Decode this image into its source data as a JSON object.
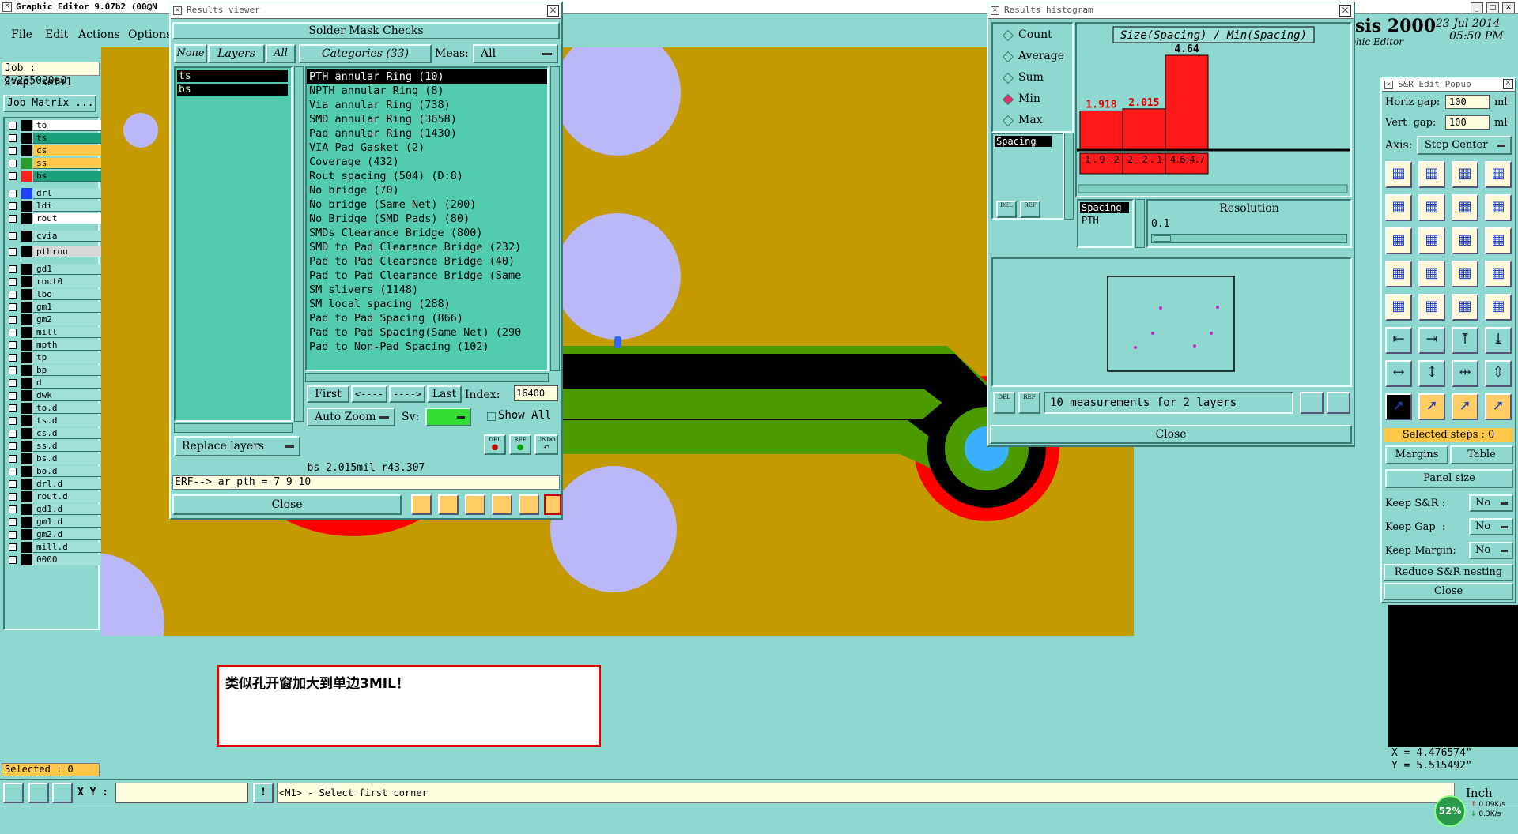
{
  "app": {
    "title": "Graphic Editor 9.07b2 (00@N",
    "menu": [
      "File",
      "Edit",
      "Actions",
      "Options"
    ],
    "job": "Job : 2v255020a0",
    "step": "Step: set+1",
    "job_matrix": "Job Matrix ...",
    "selected": "Selected : 0",
    "brand": "esis 2000",
    "brand_sub": "aphic Editor",
    "date": "23 Jul 2014",
    "time": "05:50 PM"
  },
  "layers": [
    {
      "name": "to",
      "color": "#ffffff",
      "sw": "#000000"
    },
    {
      "name": "ts",
      "color": "#1aa07a",
      "sw": "#000000"
    },
    {
      "name": "cs",
      "color": "#ffc84a",
      "sw": "#000000"
    },
    {
      "name": "ss",
      "color": "#ffc84a",
      "sw": "#2a9a2a"
    },
    {
      "name": "bs",
      "color": "#1aa07a",
      "sw": "#ff2020"
    },
    {
      "name": "drl",
      "color": "#9fe0d8",
      "sw": "#2040ff"
    },
    {
      "name": "ldi",
      "color": "#9fe0d8",
      "sw": "#000000"
    },
    {
      "name": "rout",
      "color": "#ffffff",
      "sw": "#000000"
    },
    {
      "name": "cvia",
      "color": "#9fe0d8",
      "sw": "#000000"
    },
    {
      "name": "pthrou",
      "color": "#d8d8d8",
      "sw": "#000000"
    },
    {
      "name": "gd1",
      "color": "#9fe0d8",
      "sw": "#000000"
    },
    {
      "name": "rout0",
      "color": "#9fe0d8",
      "sw": "#000000"
    },
    {
      "name": "lbo",
      "color": "#9fe0d8",
      "sw": "#000000"
    },
    {
      "name": "gm1",
      "color": "#9fe0d8",
      "sw": "#000000"
    },
    {
      "name": "gm2",
      "color": "#9fe0d8",
      "sw": "#000000"
    },
    {
      "name": "mill",
      "color": "#9fe0d8",
      "sw": "#000000"
    },
    {
      "name": "mpth",
      "color": "#9fe0d8",
      "sw": "#000000"
    },
    {
      "name": "tp",
      "color": "#9fe0d8",
      "sw": "#000000"
    },
    {
      "name": "bp",
      "color": "#9fe0d8",
      "sw": "#000000"
    },
    {
      "name": "d",
      "color": "#9fe0d8",
      "sw": "#000000"
    },
    {
      "name": "dwk",
      "color": "#9fe0d8",
      "sw": "#000000"
    },
    {
      "name": "to.d",
      "color": "#9fe0d8",
      "sw": "#000000"
    },
    {
      "name": "ts.d",
      "color": "#9fe0d8",
      "sw": "#000000"
    },
    {
      "name": "cs.d",
      "color": "#9fe0d8",
      "sw": "#000000"
    },
    {
      "name": "ss.d",
      "color": "#9fe0d8",
      "sw": "#000000"
    },
    {
      "name": "bs.d",
      "color": "#9fe0d8",
      "sw": "#000000"
    },
    {
      "name": "bo.d",
      "color": "#9fe0d8",
      "sw": "#000000"
    },
    {
      "name": "drl.d",
      "color": "#9fe0d8",
      "sw": "#000000"
    },
    {
      "name": "rout.d",
      "color": "#9fe0d8",
      "sw": "#000000"
    },
    {
      "name": "gd1.d",
      "color": "#9fe0d8",
      "sw": "#000000"
    },
    {
      "name": "gm1.d",
      "color": "#9fe0d8",
      "sw": "#000000"
    },
    {
      "name": "gm2.d",
      "color": "#9fe0d8",
      "sw": "#000000"
    },
    {
      "name": "mill.d",
      "color": "#9fe0d8",
      "sw": "#000000"
    },
    {
      "name": "0000",
      "color": "#9fe0d8",
      "sw": "#000000"
    }
  ],
  "results": {
    "title": "Results viewer",
    "header": "Solder Mask Checks",
    "none": "None",
    "layers_tab": "Layers",
    "all": "All",
    "categories": "Categories (33)",
    "meas_label": "Meas:",
    "meas_value": "All",
    "layer_list": [
      "ts",
      "bs"
    ],
    "items": [
      "PTH annular Ring (10)",
      "NPTH annular Ring (8)",
      "Via annular Ring (738)",
      "SMD annular Ring (3658)",
      "Pad annular Ring (1430)",
      "VIA Pad Gasket (2)",
      "Coverage (432)",
      "Rout spacing (504)        (D:8)",
      "No bridge (70)",
      "No bridge (Same Net) (200)",
      "No Bridge (SMD Pads) (80)",
      "SMDs Clearance Bridge (800)",
      "SMD to Pad Clearance Bridge (232)",
      "Pad to Pad Clearance Bridge (40)",
      "Pad to Pad Clearance Bridge (Same",
      "SM slivers (1148)",
      "SM local spacing (288)",
      "Pad to Pad Spacing (866)",
      "Pad to Pad Spacing(Same Net) (290",
      "Pad to Non-Pad Spacing (102)"
    ],
    "first": "First",
    "prev": "<----",
    "next": "---->",
    "last": "Last",
    "index_label": "Index:",
    "index_value": "16400",
    "auto_zoom": "Auto Zoom",
    "sv": "Sv:",
    "show_all": "Show All",
    "replace": "Replace layers",
    "status": "bs 2.015mil  r43.307",
    "erf": "ERF--> ar_pth = 7 9 10",
    "close": "Close",
    "del": "DEL",
    "ref": "REF",
    "undo": "UNDO"
  },
  "histogram": {
    "title": "Results histogram",
    "options": [
      "Count",
      "Average",
      "Sum",
      "Min",
      "Max"
    ],
    "selected_option": "Min",
    "list1": "Spacing",
    "chart_title": "Size(Spacing) / Min(Spacing)",
    "list2": [
      "Spacing",
      "PTH"
    ],
    "resolution_label": "Resolution",
    "resolution_value": "0.1",
    "info": "10 measurements for 2 layers",
    "close": "Close",
    "del": "DEL",
    "ref": "REF"
  },
  "chart_data": {
    "type": "bar",
    "title": "Size(Spacing) / Min(Spacing)",
    "categories": [
      "1.9-2",
      "2-2.1",
      "4.6-4.7"
    ],
    "values": [
      1.918,
      2.015,
      4.64
    ],
    "value_labels": [
      "1.918",
      "2.015",
      "4.64"
    ],
    "label_colors": [
      "#e00000",
      "#e00000",
      "#000000"
    ],
    "ylim": [
      0,
      5
    ]
  },
  "sr": {
    "title": "S&R Edit Popup",
    "hgap_label": "Horiz gap:",
    "hgap_value": "100",
    "vgap_label": "Vert  gap:",
    "vgap_value": "100",
    "unit": "ml",
    "axis_label": "Axis:",
    "axis_value": "Step Center",
    "selected_steps": "Selected steps : 0",
    "margins": "Margins",
    "table": "Table",
    "panel_size": "Panel size",
    "keep_sr": "Keep S&R :",
    "keep_gap": "Keep Gap  :",
    "keep_margin": "Keep Margin:",
    "no": "No",
    "reduce": "Reduce S&R nesting",
    "close": "Close"
  },
  "coords": {
    "x": "X = 4.476574\"",
    "y": "Y = 5.515492\""
  },
  "bottom": {
    "xy_label": "X Y :",
    "prompt": "<M1> - Select first corner",
    "unit": "Inch",
    "cpu": "52%",
    "up": "0.09K/s",
    "down": "0.3K/s"
  },
  "note": "类似孔开窗加大到单边3MIL！",
  "colors": {
    "board": "#c39a00",
    "pad": "#bbb8fa",
    "track": "#000000",
    "green": "#4a9a00",
    "ring": "#ff0000",
    "cyan": "#3ab0ff",
    "panel": "#8fd8d0",
    "list": "#52ccae"
  }
}
